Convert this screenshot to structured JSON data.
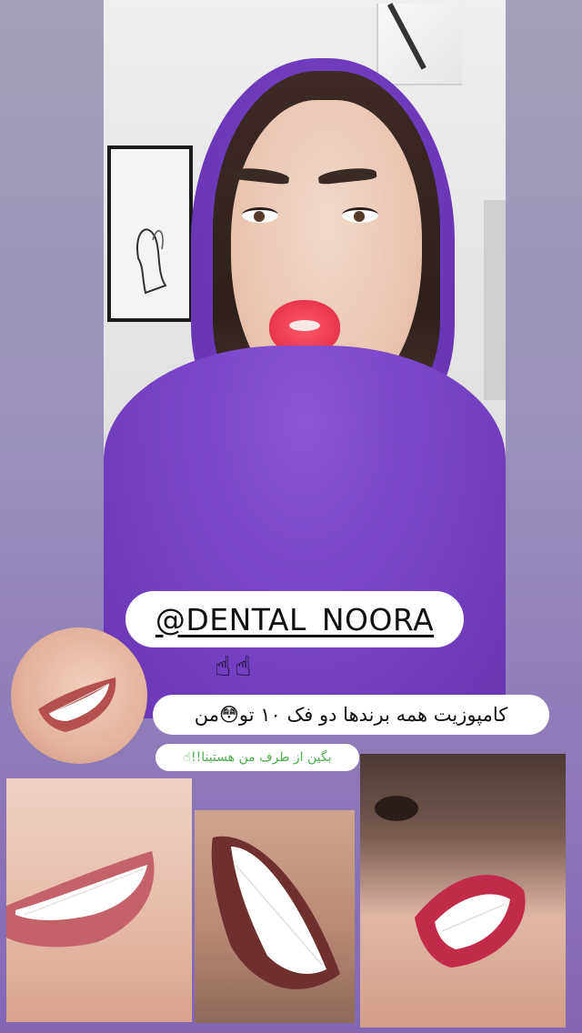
{
  "overlay": {
    "handle": "@DENTAL_NOORA",
    "hands": "☝☝",
    "caption": "کامپوزیت همه برندها دو فک ۱۰ تو😳من",
    "subcaption": "بگین از طرف من هستینا!!☝"
  },
  "colors": {
    "background_top": "#a3a0b8",
    "background_bottom": "#8466b5",
    "scarf": "#7a45c8",
    "lips": "#e8364c",
    "subcaption_text": "#4caf50"
  }
}
